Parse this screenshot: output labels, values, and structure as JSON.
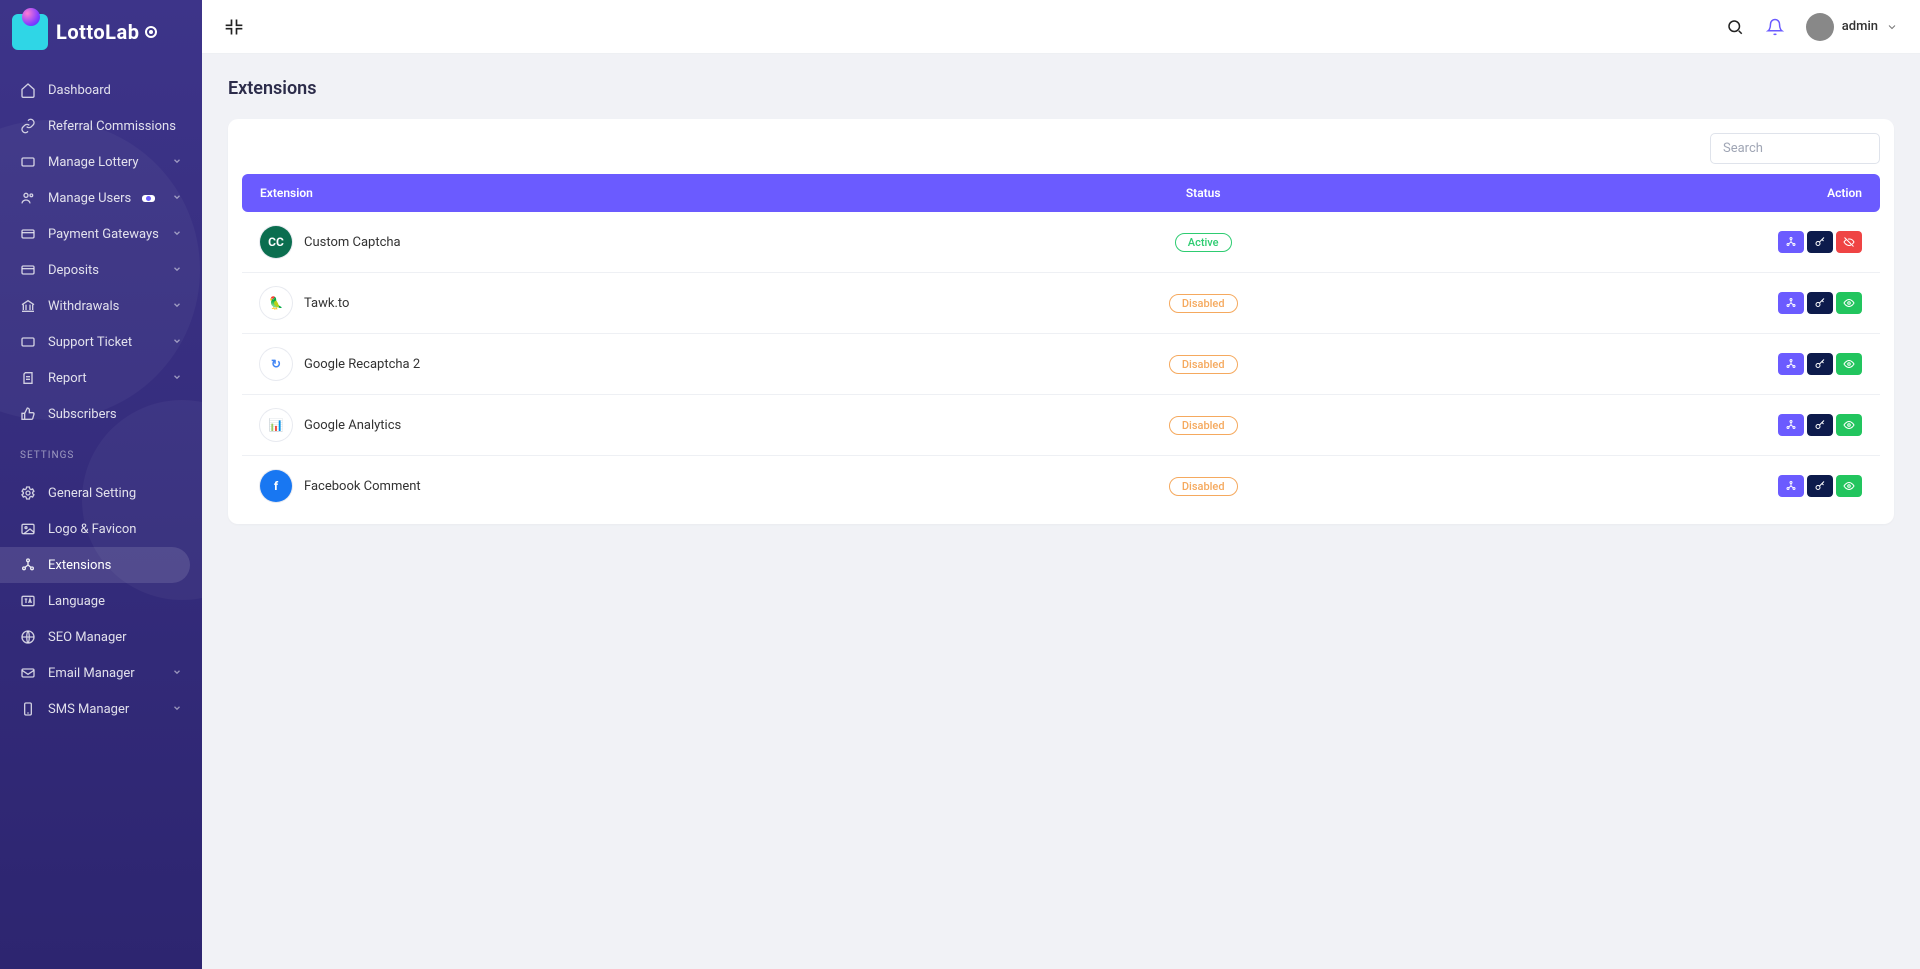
{
  "brand": "LottoLab",
  "header": {
    "user": "admin"
  },
  "page": {
    "title": "Extensions"
  },
  "search": {
    "placeholder": "Search"
  },
  "table": {
    "cols": {
      "ext": "Extension",
      "status": "Status",
      "action": "Action"
    }
  },
  "status_labels": {
    "active": "Active",
    "disabled": "Disabled"
  },
  "nav": {
    "main": [
      {
        "label": "Dashboard",
        "icon": "home",
        "expand": false
      },
      {
        "label": "Referral Commissions",
        "icon": "link",
        "expand": false
      },
      {
        "label": "Manage Lottery",
        "icon": "ticket",
        "expand": true
      },
      {
        "label": "Manage Users",
        "icon": "users",
        "expand": true,
        "badge": true
      },
      {
        "label": "Payment Gateways",
        "icon": "card",
        "expand": true
      },
      {
        "label": "Deposits",
        "icon": "card",
        "expand": true
      },
      {
        "label": "Withdrawals",
        "icon": "bank",
        "expand": true
      },
      {
        "label": "Support Ticket",
        "icon": "ticket",
        "expand": true
      },
      {
        "label": "Report",
        "icon": "report",
        "expand": true
      },
      {
        "label": "Subscribers",
        "icon": "thumb",
        "expand": false
      }
    ],
    "settings_heading": "SETTINGS",
    "settings": [
      {
        "label": "General Setting",
        "icon": "gear",
        "expand": false
      },
      {
        "label": "Logo & Favicon",
        "icon": "image",
        "expand": false
      },
      {
        "label": "Extensions",
        "icon": "puzzle",
        "expand": false,
        "active": true
      },
      {
        "label": "Language",
        "icon": "lang",
        "expand": false
      },
      {
        "label": "SEO Manager",
        "icon": "globe",
        "expand": false
      },
      {
        "label": "Email Manager",
        "icon": "mail",
        "expand": true
      },
      {
        "label": "SMS Manager",
        "icon": "phone",
        "expand": true
      }
    ]
  },
  "extensions": [
    {
      "name": "Custom Captcha",
      "status": "active",
      "icon_bg": "#0b6e4f",
      "icon_text": "CC"
    },
    {
      "name": "Tawk.to",
      "status": "disabled",
      "icon_bg": "#ffffff",
      "icon_text": "🦜"
    },
    {
      "name": "Google Recaptcha 2",
      "status": "disabled",
      "icon_bg": "#ffffff",
      "icon_text": "↻"
    },
    {
      "name": "Google Analytics",
      "status": "disabled",
      "icon_bg": "#ffffff",
      "icon_text": "📊"
    },
    {
      "name": "Facebook Comment",
      "status": "disabled",
      "icon_bg": "#1877f2",
      "icon_text": "f"
    }
  ]
}
